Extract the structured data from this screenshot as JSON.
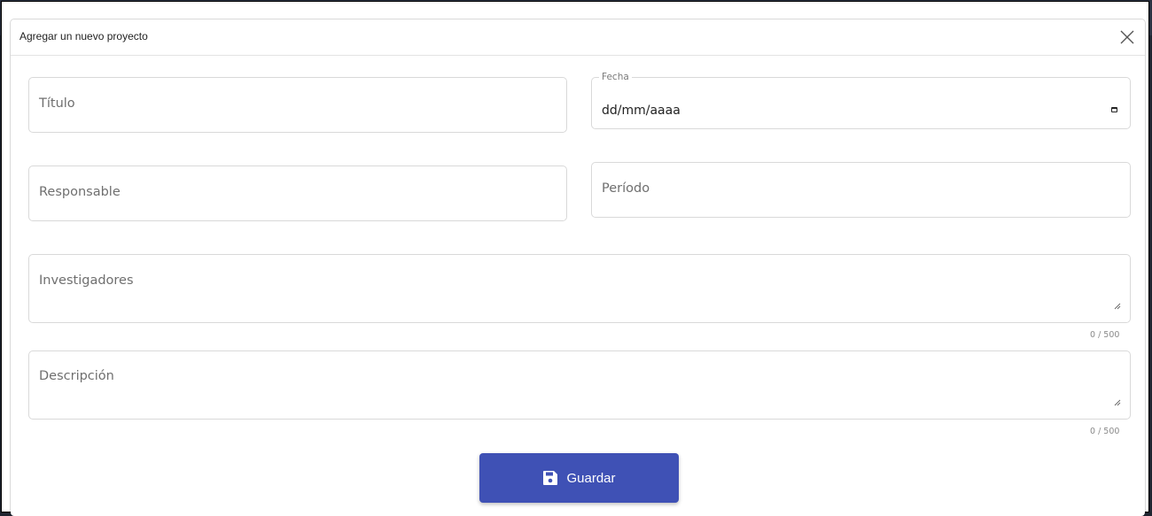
{
  "dialog": {
    "title": "Agregar un nuevo proyecto",
    "close_icon": "close-icon"
  },
  "fields": {
    "titulo": {
      "placeholder": "Título"
    },
    "fecha": {
      "label": "Fecha",
      "value": "dd/mm/aaaa",
      "icon": "calendar-icon"
    },
    "responsable": {
      "placeholder": "Responsable"
    },
    "periodo": {
      "placeholder": "Período"
    },
    "investigadores": {
      "placeholder": "Investigadores",
      "counter": "0 / 500"
    },
    "descripcion": {
      "placeholder": "Descripción",
      "counter": "0 / 500"
    }
  },
  "actions": {
    "save_label": "Guardar",
    "save_icon": "floppy-disk-icon"
  },
  "colors": {
    "primary": "#3f51b5",
    "border": "#d9d9d9",
    "placeholder": "#6f6f6f"
  }
}
